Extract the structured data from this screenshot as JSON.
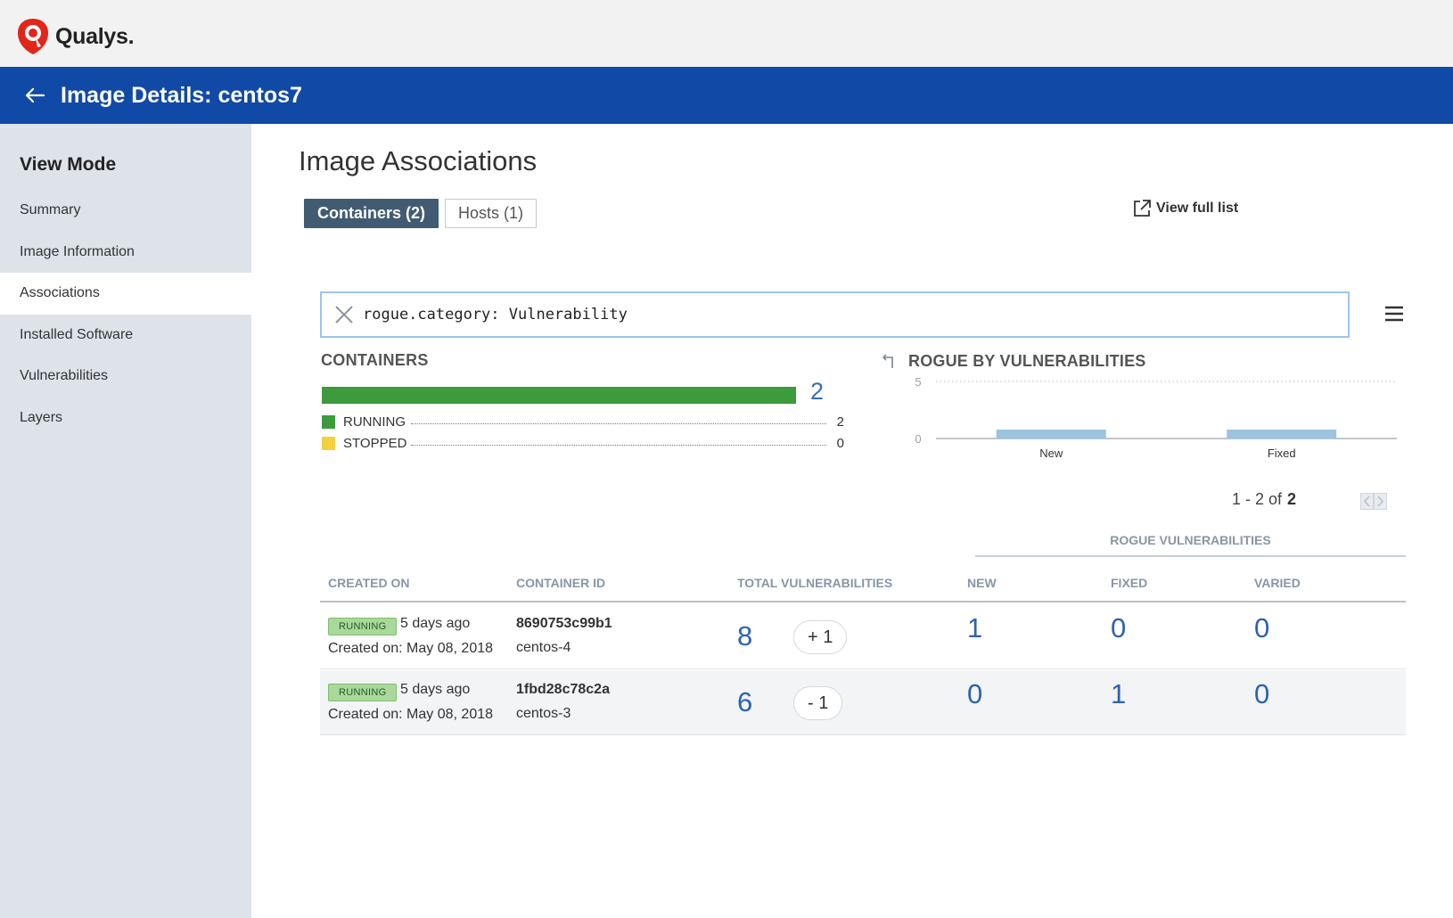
{
  "brand": {
    "name": "Qualys."
  },
  "header": {
    "title": "Image Details: centos7"
  },
  "sidebar": {
    "heading": "View Mode",
    "items": [
      {
        "label": "Summary",
        "active": false
      },
      {
        "label": "Image Information",
        "active": false
      },
      {
        "label": "Associations",
        "active": true
      },
      {
        "label": "Installed Software",
        "active": false
      },
      {
        "label": "Vulnerabilities",
        "active": false
      },
      {
        "label": "Layers",
        "active": false
      }
    ]
  },
  "main": {
    "title": "Image Associations",
    "tabs": [
      {
        "label": "Containers (2)",
        "active": true
      },
      {
        "label": "Hosts (1)",
        "active": false
      }
    ],
    "view_full_list": "View full list",
    "search": {
      "value": "rogue.category: Vulnerability"
    }
  },
  "containers_summary": {
    "title": "CONTAINERS",
    "total": "2",
    "legend": [
      {
        "label": "RUNNING",
        "value": "2",
        "color": "#3d9a3d"
      },
      {
        "label": "STOPPED",
        "value": "0",
        "color": "#f4d03f"
      }
    ]
  },
  "chart_data": {
    "type": "bar",
    "title": "ROGUE BY VULNERABILITIES",
    "categories": [
      "New",
      "Fixed"
    ],
    "values": [
      1,
      1
    ],
    "ylim": [
      0,
      5
    ],
    "yticks": [
      "0",
      "5"
    ],
    "color": "#9cc3df",
    "grid": true
  },
  "pager": {
    "range": "1 - 2 of",
    "total": "2"
  },
  "table": {
    "group_header": "ROGUE VULNERABILITIES",
    "columns": {
      "created_on": "CREATED ON",
      "container_id": "CONTAINER ID",
      "total_vulns": "TOTAL VULNERABILITIES",
      "new": "NEW",
      "fixed": "FIXED",
      "varied": "VARIED"
    },
    "rows": [
      {
        "status": "RUNNING",
        "age": "5 days ago",
        "created": "Created on: May 08, 2018",
        "container_id": "8690753c99b1",
        "name": "centos-4",
        "total": "8",
        "delta": "+ 1",
        "new": "1",
        "fixed": "0",
        "varied": "0"
      },
      {
        "status": "RUNNING",
        "age": "5 days ago",
        "created": "Created on: May 08, 2018",
        "container_id": "1fbd28c78c2a",
        "name": "centos-3",
        "total": "6",
        "delta": "- 1",
        "new": "0",
        "fixed": "1",
        "varied": "0"
      }
    ]
  },
  "colors": {
    "header_blue": "#114aa6",
    "accent_blue": "#2d62b0",
    "running_green": "#3d9a3d",
    "stopped_yellow": "#f4d03f",
    "tab_active": "#415c72"
  }
}
